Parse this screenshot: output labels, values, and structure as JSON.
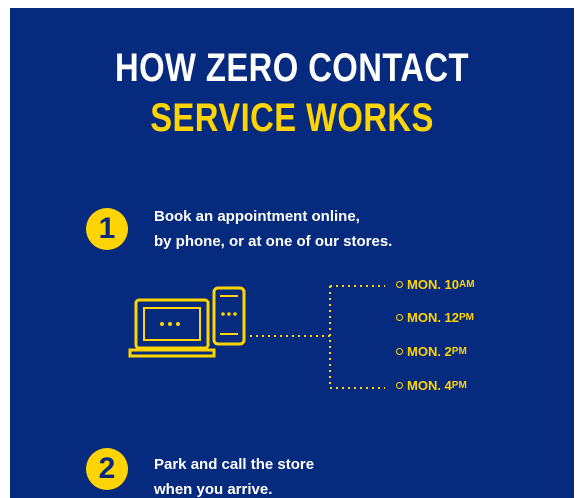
{
  "title": {
    "line1": "HOW ZERO CONTACT",
    "line2": "SERVICE WORKS"
  },
  "colors": {
    "background": "#062a7e",
    "accent": "#ffd400",
    "text": "#ffffff"
  },
  "steps": [
    {
      "number": "1",
      "line1": "Book an appointment online,",
      "line2": "by phone, or at one of our stores."
    },
    {
      "number": "2",
      "line1": "Park and call the store",
      "line2": "when you arrive."
    }
  ],
  "devices_icon": "laptop-and-phone-icon",
  "time_slots": [
    {
      "day": "MON. 10",
      "ampm": "AM"
    },
    {
      "day": "MON. 12",
      "ampm": "PM"
    },
    {
      "day": "MON. 2",
      "ampm": "PM"
    },
    {
      "day": "MON. 4",
      "ampm": "PM"
    }
  ]
}
